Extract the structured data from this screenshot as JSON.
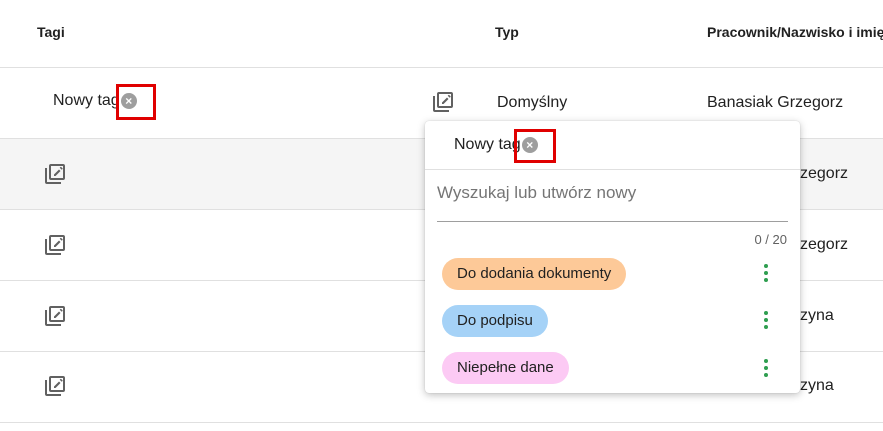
{
  "table": {
    "headers": {
      "tags": "Tagi",
      "type": "Typ",
      "employee": "Pracownik/Nazwisko i imię"
    },
    "rows": [
      {
        "tag": "Nowy tag",
        "type": "Domyślny",
        "employee": "Banasiak Grzegorz"
      },
      {
        "employee_visible": "zegorz"
      },
      {
        "employee_visible": "zegorz"
      },
      {
        "employee_visible": "zyna"
      },
      {
        "employee_visible": "zyna"
      }
    ]
  },
  "dropdown": {
    "selected_tag": "Nowy tag",
    "search_placeholder": "Wyszukaj lub utwórz nowy",
    "counter": "0 / 20",
    "options": [
      {
        "label": "Do dodania dokumenty",
        "color": "#fdc998"
      },
      {
        "label": "Do podpisu",
        "color": "#a5d2f7"
      },
      {
        "label": "Niepełne dane",
        "color": "#fccaf4"
      }
    ]
  },
  "icons": {
    "edit": "edit-note-icon",
    "remove": "close-circle-icon",
    "menu": "more-vert-icon"
  },
  "colors": {
    "highlight": "#e00000",
    "menu_dots": "#2e9e4f"
  }
}
